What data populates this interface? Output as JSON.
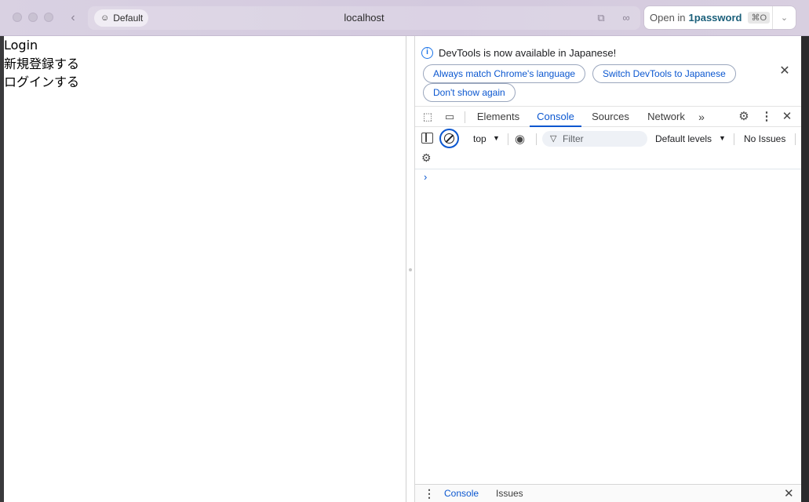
{
  "window": {
    "profile_label": "Default",
    "url": "localhost",
    "onepassword": {
      "prefix": "Open in",
      "brand": "1password",
      "shortcut": "⌘O"
    },
    "icons": [
      "back-chevron-icon",
      "profile-icon",
      "extension-icon",
      "link-icon",
      "chevron-down-icon"
    ]
  },
  "page": {
    "lines": [
      "Login",
      "新規登録する",
      "ログインする"
    ]
  },
  "devtools": {
    "infobar": {
      "message": "DevTools is now available in Japanese!",
      "buttons": {
        "match": "Always match Chrome's language",
        "switch": "Switch DevTools to Japanese",
        "dont_show": "Don't show again"
      }
    },
    "tabs": {
      "elements": "Elements",
      "console": "Console",
      "sources": "Sources",
      "network": "Network",
      "more": "»",
      "active": "Console"
    },
    "console_toolbar": {
      "context": "top",
      "filter_placeholder": "Filter",
      "levels": "Default levels",
      "issues": "No Issues"
    },
    "prompt": "›",
    "drawer": {
      "console": "Console",
      "issues": "Issues"
    }
  },
  "colors": {
    "accent": "#0b57d0",
    "titlebar": "#d6cde0",
    "onepassword_brand": "#1a5f7a"
  }
}
